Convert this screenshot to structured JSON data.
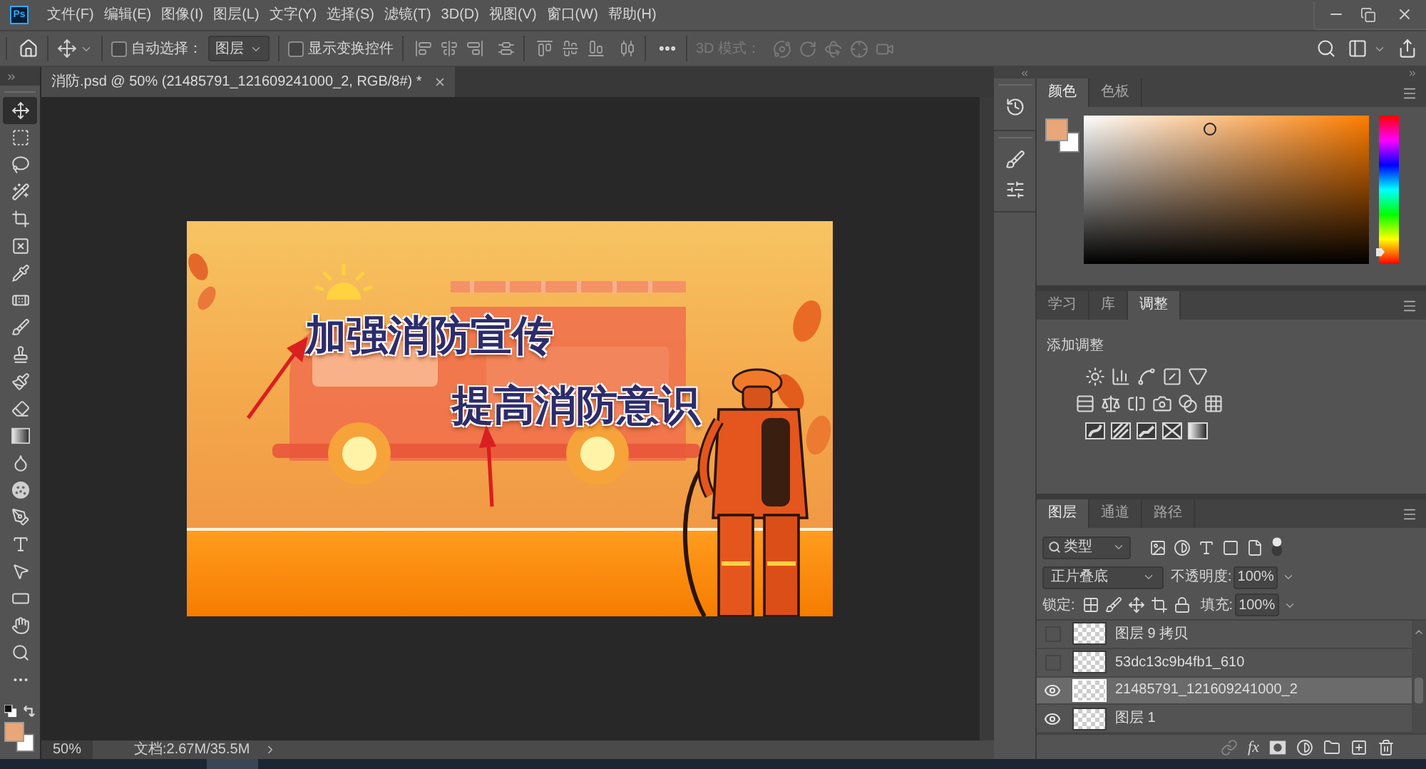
{
  "app": {
    "logo": "Ps"
  },
  "menu_bar": [
    "文件(F)",
    "编辑(E)",
    "图像(I)",
    "图层(L)",
    "文字(Y)",
    "选择(S)",
    "滤镜(T)",
    "3D(D)",
    "视图(V)",
    "窗口(W)",
    "帮助(H)"
  ],
  "options_bar": {
    "auto_select": {
      "label": "自动选择：",
      "checked": false
    },
    "auto_select_target": "图层",
    "show_transform_controls": {
      "label": "显示变换控件",
      "checked": false
    },
    "mode_3d_label": "3D 模式："
  },
  "document_tab": {
    "title": "消防.psd @ 50% (21485791_121609241000_2, RGB/8#) *"
  },
  "tools": [
    {
      "kind": "move",
      "selected": true
    },
    {
      "kind": "marquee",
      "selected": false
    },
    {
      "kind": "lasso",
      "selected": false
    },
    {
      "kind": "quick_select",
      "selected": false
    },
    {
      "kind": "crop",
      "selected": false
    },
    {
      "kind": "frame",
      "selected": false
    },
    {
      "kind": "eyedropper",
      "selected": false
    },
    {
      "kind": "healing",
      "selected": false
    },
    {
      "kind": "brush",
      "selected": false
    },
    {
      "kind": "stamp",
      "selected": false
    },
    {
      "kind": "history_brush",
      "selected": false
    },
    {
      "kind": "eraser",
      "selected": false
    },
    {
      "kind": "gradient",
      "selected": false
    },
    {
      "kind": "blur",
      "selected": false
    },
    {
      "kind": "sponge",
      "selected": false
    },
    {
      "kind": "pen",
      "selected": false
    },
    {
      "kind": "type",
      "selected": false
    },
    {
      "kind": "path_select",
      "selected": false
    },
    {
      "kind": "shape",
      "selected": false
    },
    {
      "kind": "hand",
      "selected": false
    },
    {
      "kind": "zoom",
      "selected": false
    },
    {
      "kind": "more",
      "selected": false
    }
  ],
  "artwork": {
    "headline_1": "加强消防宣传",
    "headline_2": "提高消防意识"
  },
  "status_bar": {
    "zoom": "50%",
    "document_size": "文档:2.67M/35.5M"
  },
  "color_panel": {
    "tabs": [
      {
        "label": "颜色",
        "selected": true
      },
      {
        "label": "色板",
        "selected": false
      }
    ],
    "hue": {
      "level": 0.08
    }
  },
  "adjustments_panel": {
    "tabs": [
      {
        "label": "学习",
        "selected": false
      },
      {
        "label": "库",
        "selected": false
      },
      {
        "label": "调整",
        "selected": true
      }
    ],
    "title": "添加调整"
  },
  "layers_panel": {
    "tabs": [
      {
        "label": "图层",
        "selected": true
      },
      {
        "label": "通道",
        "selected": false
      },
      {
        "label": "路径",
        "selected": false
      }
    ],
    "filter": "类型",
    "blend_mode": "正片叠底",
    "opacity_label": "不透明度:",
    "opacity": "100%",
    "lock_label": "锁定:",
    "fill_label": "填充:",
    "fill": "100%",
    "layers": [
      {
        "name": "图层 9 拷贝",
        "visible": false,
        "selected": false
      },
      {
        "name": "53dc13c9b4fb1_610",
        "visible": false,
        "selected": false
      },
      {
        "name": "21485791_121609241000_2",
        "visible": true,
        "selected": true
      },
      {
        "name": "图层 1",
        "visible": true,
        "selected": false
      }
    ],
    "effects_label": "fx"
  }
}
